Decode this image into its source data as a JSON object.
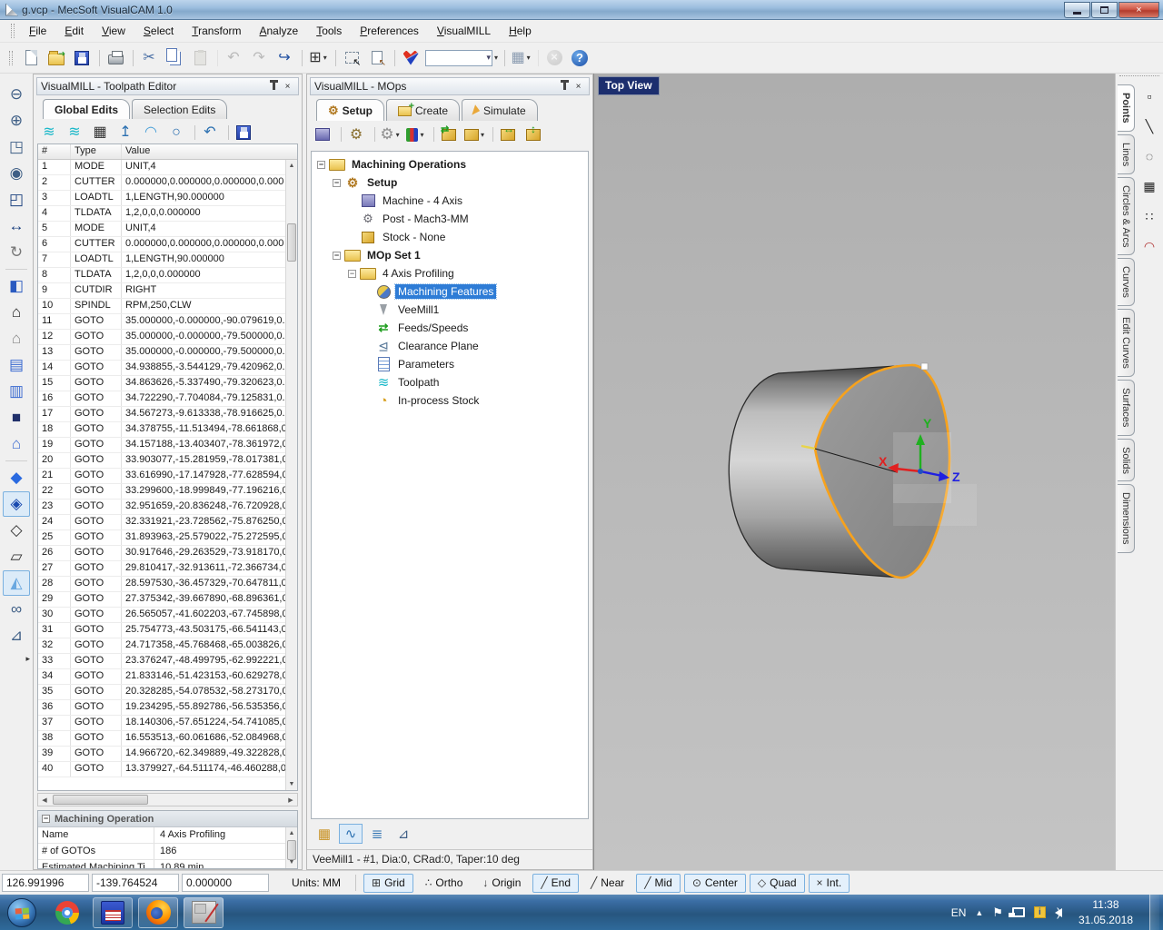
{
  "window": {
    "title": "g.vcp - MecSoft VisualCAM 1.0"
  },
  "menu": {
    "items": [
      "File",
      "Edit",
      "View",
      "Select",
      "Transform",
      "Analyze",
      "Tools",
      "Preferences",
      "VisualMILL",
      "Help"
    ]
  },
  "toolbar": {
    "icons": [
      {
        "name": "new-document-button",
        "kind": "page"
      },
      {
        "name": "open-file-button",
        "kind": "folder"
      },
      {
        "name": "save-file-button",
        "kind": "floppy"
      },
      {
        "name": "print-button",
        "kind": "printer",
        "sep_before": true
      },
      {
        "name": "cut-button",
        "kind": "glyph",
        "glyph": "✂",
        "color": "#4a6fa5",
        "sep_before": true
      },
      {
        "name": "copy-button",
        "kind": "copy"
      },
      {
        "name": "paste-button",
        "kind": "paste",
        "disabled": true
      },
      {
        "name": "undo-button",
        "kind": "glyph",
        "glyph": "↶",
        "color": "#555",
        "disabled": true,
        "sep_before": true
      },
      {
        "name": "redo-button",
        "kind": "glyph",
        "glyph": "↷",
        "color": "#555",
        "disabled": true
      },
      {
        "name": "repeat-last-button",
        "kind": "glyph",
        "glyph": "↪",
        "color": "#1f4fa0"
      },
      {
        "name": "viewport-layout-button",
        "kind": "glyph",
        "glyph": "⊞",
        "color": "#333",
        "dropdown": true,
        "sep_before": true
      },
      {
        "name": "pick-select-button",
        "kind": "select",
        "sep_before": true
      },
      {
        "name": "selection-info-button",
        "kind": "page2"
      },
      {
        "name": "visualmill-logo",
        "kind": "shield",
        "sep_before": true
      },
      {
        "name": "layer-combobox",
        "kind": "combo",
        "dropdown": true
      },
      {
        "name": "grid-settings-button",
        "kind": "glyph",
        "glyph": "▦",
        "color": "#8a9bb0",
        "dropdown": true,
        "sep_before": true
      },
      {
        "name": "stop-button",
        "kind": "circle-x",
        "disabled": true,
        "sep_before": true
      },
      {
        "name": "help-button",
        "kind": "help"
      }
    ]
  },
  "left_toolbar": {
    "icons": [
      {
        "name": "zoom-out-icon",
        "glyph": "⊖",
        "color": "#3f5f86"
      },
      {
        "name": "zoom-in-icon",
        "glyph": "⊕",
        "color": "#3f5f86"
      },
      {
        "name": "zoom-window-icon",
        "glyph": "◳",
        "color": "#3f5f86"
      },
      {
        "name": "zoom-selected-icon",
        "glyph": "◉",
        "color": "#3f5f86"
      },
      {
        "name": "zoom-extents-icon",
        "glyph": "◰",
        "color": "#1a3f7e"
      },
      {
        "name": "pan-icon",
        "glyph": "↔",
        "color": "#1a3f7e"
      },
      {
        "name": "rotate-view-icon",
        "glyph": "↻",
        "color": "#777777",
        "sep_after": true
      },
      {
        "name": "view-cube-icon",
        "glyph": "◧",
        "color": "#2a5ac0"
      },
      {
        "name": "front-view-icon",
        "glyph": "⌂",
        "color": "#222222"
      },
      {
        "name": "back-view-icon",
        "glyph": "⌂",
        "color": "#888888"
      },
      {
        "name": "top-view-icon",
        "glyph": "▤",
        "color": "#3a6ad0"
      },
      {
        "name": "bottom-view-icon",
        "glyph": "▥",
        "color": "#3a6ad0"
      },
      {
        "name": "left-view-icon",
        "glyph": "■",
        "color": "#20306a"
      },
      {
        "name": "isometric-view-icon",
        "glyph": "⌂",
        "color": "#3a6ad0",
        "sep_after": true
      },
      {
        "name": "shaded-display-icon",
        "glyph": "◆",
        "color": "#2a6ae0"
      },
      {
        "name": "shaded-edges-display-icon",
        "glyph": "◈",
        "color": "#1a4ab0",
        "selected": true
      },
      {
        "name": "hidden-line-display-icon",
        "glyph": "◇",
        "color": "#333333"
      },
      {
        "name": "wireframe-display-icon",
        "glyph": "▱",
        "color": "#333333"
      },
      {
        "name": "toolpath-display-icon",
        "glyph": "◭",
        "color": "#6aa8e0",
        "selected": true
      },
      {
        "name": "simulation-glasses-icon",
        "glyph": "∞",
        "color": "#3f5f86"
      },
      {
        "name": "world-axes-icon",
        "glyph": "⊿",
        "color": "#3f5f86"
      }
    ]
  },
  "toolpath_editor": {
    "title": "VisualMILL - Toolpath Editor",
    "tabs": [
      {
        "label": "Global Edits",
        "active": true
      },
      {
        "label": "Selection Edits"
      }
    ],
    "tools": [
      {
        "name": "edit-toolpath-point-button",
        "kind": "glyph",
        "glyph": "≋",
        "color": "#16b7c8"
      },
      {
        "name": "reverse-toolpath-button",
        "kind": "glyph",
        "glyph": "≋",
        "color": "#16b7c8"
      },
      {
        "name": "point-grid-button",
        "kind": "glyph",
        "glyph": "▦",
        "color": "#333333"
      },
      {
        "name": "reorder-levels-button",
        "kind": "glyph",
        "glyph": "↥",
        "color": "#2a6fb0"
      },
      {
        "name": "fillet-arc-button",
        "kind": "glyph",
        "glyph": "◠",
        "color": "#4aa0d8"
      },
      {
        "name": "circle-fit-button",
        "kind": "glyph",
        "glyph": "○",
        "color": "#2a6fb0"
      },
      {
        "name": "undo-edit-button",
        "kind": "glyph",
        "glyph": "↶",
        "color": "#2a6fb0",
        "sep_before": true
      },
      {
        "name": "save-toolpath-button",
        "kind": "floppy",
        "sep_before": true
      }
    ],
    "table": {
      "columns": [
        "#",
        "Type",
        "Value"
      ],
      "rows": [
        {
          "n": "1",
          "type": "MODE",
          "value": "UNIT,4"
        },
        {
          "n": "2",
          "type": "CUTTER",
          "value": "0.000000,0.000000,0.000000,0.000"
        },
        {
          "n": "3",
          "type": "LOADTL",
          "value": "1,LENGTH,90.000000"
        },
        {
          "n": "4",
          "type": "TLDATA",
          "value": "1,2,0,0,0.000000"
        },
        {
          "n": "5",
          "type": "MODE",
          "value": "UNIT,4"
        },
        {
          "n": "6",
          "type": "CUTTER",
          "value": "0.000000,0.000000,0.000000,0.000"
        },
        {
          "n": "7",
          "type": "LOADTL",
          "value": "1,LENGTH,90.000000"
        },
        {
          "n": "8",
          "type": "TLDATA",
          "value": "1,2,0,0,0.000000"
        },
        {
          "n": "9",
          "type": "CUTDIR",
          "value": "RIGHT"
        },
        {
          "n": "10",
          "type": "SPINDL",
          "value": "RPM,250,CLW"
        },
        {
          "n": "11",
          "type": "GOTO",
          "value": "35.000000,-0.000000,-90.079619,0."
        },
        {
          "n": "12",
          "type": "GOTO",
          "value": "35.000000,-0.000000,-79.500000,0."
        },
        {
          "n": "13",
          "type": "GOTO",
          "value": "35.000000,-0.000000,-79.500000,0."
        },
        {
          "n": "14",
          "type": "GOTO",
          "value": "34.938855,-3.544129,-79.420962,0."
        },
        {
          "n": "15",
          "type": "GOTO",
          "value": "34.863626,-5.337490,-79.320623,0."
        },
        {
          "n": "16",
          "type": "GOTO",
          "value": "34.722290,-7.704084,-79.125831,0."
        },
        {
          "n": "17",
          "type": "GOTO",
          "value": "34.567273,-9.613338,-78.916625,0."
        },
        {
          "n": "18",
          "type": "GOTO",
          "value": "34.378755,-11.513494,-78.661868,0"
        },
        {
          "n": "19",
          "type": "GOTO",
          "value": "34.157188,-13.403407,-78.361972,0"
        },
        {
          "n": "20",
          "type": "GOTO",
          "value": "33.903077,-15.281959,-78.017381,0"
        },
        {
          "n": "21",
          "type": "GOTO",
          "value": "33.616990,-17.147928,-77.628594,0"
        },
        {
          "n": "22",
          "type": "GOTO",
          "value": "33.299600,-18.999849,-77.196216,0"
        },
        {
          "n": "23",
          "type": "GOTO",
          "value": "32.951659,-20.836248,-76.720928,0"
        },
        {
          "n": "24",
          "type": "GOTO",
          "value": "32.331921,-23.728562,-75.876250,0"
        },
        {
          "n": "25",
          "type": "GOTO",
          "value": "31.893963,-25.579022,-75.272595,0"
        },
        {
          "n": "26",
          "type": "GOTO",
          "value": "30.917646,-29.263529,-73.918170,0"
        },
        {
          "n": "27",
          "type": "GOTO",
          "value": "29.810417,-32.913611,-72.366734,0"
        },
        {
          "n": "28",
          "type": "GOTO",
          "value": "28.597530,-36.457329,-70.647811,0"
        },
        {
          "n": "29",
          "type": "GOTO",
          "value": "27.375342,-39.667890,-68.896361,0"
        },
        {
          "n": "30",
          "type": "GOTO",
          "value": "26.565057,-41.602203,-67.745898,0"
        },
        {
          "n": "31",
          "type": "GOTO",
          "value": "25.754773,-43.503175,-66.541143,0"
        },
        {
          "n": "32",
          "type": "GOTO",
          "value": "24.717358,-45.768468,-65.003826,0"
        },
        {
          "n": "33",
          "type": "GOTO",
          "value": "23.376247,-48.499795,-62.992221,0"
        },
        {
          "n": "34",
          "type": "GOTO",
          "value": "21.833146,-51.423153,-60.629278,0"
        },
        {
          "n": "35",
          "type": "GOTO",
          "value": "20.328285,-54.078532,-58.273170,0"
        },
        {
          "n": "36",
          "type": "GOTO",
          "value": "19.234295,-55.892786,-56.535356,0"
        },
        {
          "n": "37",
          "type": "GOTO",
          "value": "18.140306,-57.651224,-54.741085,0"
        },
        {
          "n": "38",
          "type": "GOTO",
          "value": "16.553513,-60.061686,-52.084968,0"
        },
        {
          "n": "39",
          "type": "GOTO",
          "value": "14.966720,-62.349889,-49.322828,0"
        },
        {
          "n": "40",
          "type": "GOTO",
          "value": "13.379927,-64.511174,-46.460288,0"
        }
      ]
    },
    "properties": {
      "header": "Machining Operation",
      "rows": [
        {
          "pname": "Name",
          "pvalue": "4 Axis Profiling"
        },
        {
          "pname": "# of GOTOs",
          "pvalue": "186"
        },
        {
          "pname": "Estimated Machining Ti",
          "pvalue": "10.89 min"
        }
      ]
    }
  },
  "mops": {
    "title": "VisualMILL - MOps",
    "tabs": [
      {
        "label": "Setup",
        "icon": "gears",
        "active": true
      },
      {
        "label": "Create",
        "icon": "folder"
      },
      {
        "label": "Simulate",
        "icon": "sim"
      }
    ],
    "tools": [
      {
        "name": "machine-setup-button",
        "kind": "machine"
      },
      {
        "name": "post-processor-button",
        "kind": "gears",
        "sep_before": true
      },
      {
        "name": "setup-options-button",
        "kind": "gear-dd",
        "dropdown": true,
        "sep_before": true
      },
      {
        "name": "tools-button",
        "kind": "tools",
        "dropdown": true
      },
      {
        "name": "load-stock-button",
        "kind": "goldbox-arr",
        "sep_before": true
      },
      {
        "name": "stock-box-button",
        "kind": "goldbox",
        "dropdown": true
      },
      {
        "name": "align-stock-button",
        "kind": "box-h",
        "sep_before": true
      },
      {
        "name": "stretch-stock-button",
        "kind": "box-v"
      }
    ],
    "tree": [
      {
        "label": "Machining Operations",
        "icon": "folder",
        "indent": 0,
        "exp": true,
        "bold": true
      },
      {
        "label": "Setup",
        "icon": "gears",
        "indent": 1,
        "exp": true,
        "bold": true
      },
      {
        "label": "Machine - 4 Axis",
        "icon": "machine",
        "indent": 2
      },
      {
        "label": "Post - Mach3-MM",
        "icon": "post",
        "indent": 2
      },
      {
        "label": "Stock - None",
        "icon": "stock",
        "indent": 2
      },
      {
        "label": "MOp Set 1",
        "icon": "folder",
        "indent": 1,
        "exp": true,
        "bold": true
      },
      {
        "label": "4 Axis Profiling",
        "icon": "folder",
        "indent": 2,
        "exp": true
      },
      {
        "label": "Machining Features",
        "icon": "features",
        "indent": 3,
        "selected": true
      },
      {
        "label": "VeeMill1",
        "icon": "tool",
        "indent": 3
      },
      {
        "label": "Feeds/Speeds",
        "icon": "feeds",
        "indent": 3
      },
      {
        "label": "Clearance Plane",
        "icon": "clearance",
        "indent": 3
      },
      {
        "label": "Parameters",
        "icon": "params",
        "indent": 3
      },
      {
        "label": "Toolpath",
        "icon": "toolpath",
        "indent": 3
      },
      {
        "label": "In-process Stock",
        "icon": "inprocess",
        "indent": 3
      }
    ],
    "bottom_tools": [
      {
        "name": "simulate-stock-button",
        "glyph": "▦",
        "color": "#c89020"
      },
      {
        "name": "show-toolpath-button",
        "glyph": "∿",
        "color": "#2a6fb0",
        "selected": true
      },
      {
        "name": "show-listing-button",
        "glyph": "≣",
        "color": "#2a6fb0"
      },
      {
        "name": "machine-axes-button",
        "glyph": "⊿",
        "color": "#3f5f86"
      }
    ],
    "status": "VeeMill1 - #1, Dia:0, CRad:0, Taper:10 deg"
  },
  "viewport": {
    "view_label": "Top View",
    "axis": {
      "x": "X",
      "y": "Y",
      "z": "Z"
    },
    "colors": {
      "outline": "#f7a21c",
      "axis_x": "#e02020",
      "axis_y": "#20b020",
      "axis_z": "#2020e0"
    }
  },
  "right_panel": {
    "tabs": [
      {
        "label": "Points",
        "active": true
      },
      {
        "label": "Lines"
      },
      {
        "label": "Circles & Arcs"
      },
      {
        "label": "Curves"
      },
      {
        "label": "Edit Curves"
      },
      {
        "label": "Surfaces"
      },
      {
        "label": "Solids"
      },
      {
        "label": "Dimensions"
      }
    ],
    "tools": [
      {
        "name": "single-point-button",
        "glyph": "▫",
        "color": "#222222"
      },
      {
        "name": "points-on-line-button",
        "glyph": "╲",
        "color": "#222222"
      },
      {
        "name": "points-on-circle-button",
        "glyph": "◌",
        "color": "#222222"
      },
      {
        "name": "point-grid-button",
        "glyph": "▦",
        "color": "#222222"
      },
      {
        "name": "scatter-points-button",
        "glyph": "∷",
        "color": "#222222"
      },
      {
        "name": "points-on-curve-button",
        "glyph": "◠",
        "color": "#b03030"
      }
    ]
  },
  "statusbar": {
    "coords": [
      "126.991996",
      "-139.764524",
      "0.000000"
    ],
    "units_label": "Units: MM",
    "snaps": [
      {
        "label": "Grid",
        "glyph": "⊞",
        "active": true
      },
      {
        "label": "Ortho",
        "glyph": "∴",
        "active": false
      },
      {
        "label": "Origin",
        "glyph": "↓",
        "active": false
      },
      {
        "label": "End",
        "glyph": "╱",
        "active": true
      },
      {
        "label": "Near",
        "glyph": "╱",
        "active": false
      },
      {
        "label": "Mid",
        "glyph": "╱",
        "active": true
      },
      {
        "label": "Center",
        "glyph": "⊙",
        "active": true
      },
      {
        "label": "Quad",
        "glyph": "◇",
        "active": true
      },
      {
        "label": "Int.",
        "glyph": "×",
        "active": true
      }
    ]
  },
  "taskbar": {
    "apps": [
      {
        "name": "chrome-app",
        "kind": "chrome"
      },
      {
        "name": "saved-document-app",
        "kind": "floppy-app",
        "boxed": true
      },
      {
        "name": "firefox-app",
        "kind": "firefox",
        "boxed": true
      },
      {
        "name": "visualcam-app",
        "kind": "vcam",
        "boxed": true,
        "active": true
      }
    ],
    "tray": {
      "lang": "EN",
      "time": "11:38",
      "date": "31.05.2018"
    }
  }
}
